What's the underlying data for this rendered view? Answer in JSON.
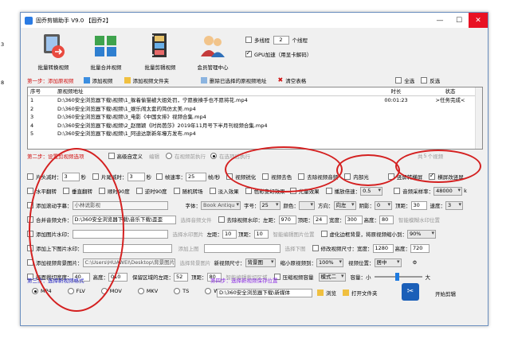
{
  "window": {
    "title": "固乔剪辑助手 V9.0 【固乔2】"
  },
  "side_marks": [
    "3",
    "8"
  ],
  "toolbar": {
    "batch_convert": "批量转换视频",
    "batch_merge": "批量合并视频",
    "batch_edit": "批量剪辑视频",
    "member": "会员管理中心",
    "multithread_label": "多线程",
    "threads_value": "2",
    "threads_unit": "个线程",
    "gpu_label": "GPU加速（用显卡解码）",
    "gpu_checked": true
  },
  "step1": {
    "label": "第一步：添加原视频",
    "add_video": "添加视频",
    "add_folder": "添加视频文件夹",
    "delete_selected": "删除已选择的原视频地址",
    "clear_table": "清空表格",
    "select_all": "全选",
    "invert": "反选"
  },
  "table": {
    "headers": [
      "序号",
      "原视频地址",
      "时长",
      "状态"
    ],
    "rows": [
      [
        "1",
        "D:\\360安全浏览器下载\\视频\\1_躲着偷猫被大姐处罚，宁愿挨揍手也不愿将花.mp4",
        "00:01:23",
        ">任务完成<"
      ],
      [
        "2",
        "D:\\360安全浏览器下载\\视频\\1_娱乐闹太套的简仿太美.mp4",
        "",
        ""
      ],
      [
        "3",
        "D:\\360安全浏览器下载\\视频\\3_电影《中国女排》视频合集.mp4",
        "",
        ""
      ],
      [
        "4",
        "D:\\360安全浏览器下载\\视频\\2_赵丽颖《时尚芭莎》2019年11月号下半月刊视频合集.mp4",
        "",
        ""
      ],
      [
        "5",
        "D:\\360安全浏览器下载\\视频\\1_阿迪达斯新年壕方发布.mp4",
        "",
        ""
      ]
    ]
  },
  "step2": {
    "label": "第二步：设置剪视频选项",
    "advanced": "高级自定义",
    "edit": "编辑",
    "before_video": "在视频前执行",
    "after_video": "在选项后执行",
    "total_label": "共",
    "total_value": "5",
    "total_unit": "个视频",
    "head_trim": "片头减时：",
    "head_val": "3",
    "sec": "秒",
    "tail_trim": "片尾减时：",
    "tail_val": "3",
    "frame_rate": "帧速率：",
    "frame_val": "25",
    "fps": "帧/秒",
    "sharpen": "视频锐化",
    "decolor": "视频去色",
    "remove_audio": "去除视频音频",
    "inner_audio": "内部光",
    "vertical_blur": "竖屏转横屏",
    "horiz_to_vert": "横屏改竖屏",
    "hflip": "水平翻转",
    "vflip": "垂直翻转",
    "rot90": "顺时90度",
    "rot_ccw": "逆时90度",
    "rand_trans": "随机转场",
    "fade": "淡入效果",
    "color_shift": "色彩变幻效果",
    "light": "光量效果",
    "speed": "播放倍速：",
    "speed_val": "0.5",
    "sample_rate": "音频采样率：",
    "sample_val": "48000",
    "add_subtitle": "添加滚动字幕：",
    "subtitle_ph": "小林说影视",
    "font_label": "字体：",
    "font_val": "Book Antiqu",
    "size_label": "字号：",
    "size_val": "25",
    "color_label": "颜色：",
    "direction": "方向：",
    "direction_val": "向左",
    "shadow": "阴影：",
    "shadow_val": "0",
    "margin_top": "顶距：",
    "margin_top_val": "30",
    "speed2": "速度：",
    "speed2_val": "3",
    "merge_music": "合并音频文件：",
    "music_path": "D:\\360安全浏览器下载\\音乐下载\\歪歪",
    "add_audio_file": "选择音频文件",
    "remove_watermark": "去除视频水印：",
    "left_label": "左距：",
    "left_val": "970",
    "top_label": "顶距：",
    "top_val": "24",
    "width_label": "宽度：",
    "width_val": "300",
    "height_label": "高度：",
    "height_val": "80",
    "smart_blur": "智能模糊水印位置",
    "add_image_watermark": "添加图片水印：",
    "choose_image": "选择水印图片",
    "left2": "左距：",
    "left2_val": "10",
    "top2": "顶距：",
    "top2_val": "10",
    "smart_watermark": "智能编辑图片位置",
    "virtual_bg": "虚化边框背景，将原视频缩小到：",
    "virtual_val": "90%",
    "add_headtail": "添加上下图片水印：",
    "add_top": "添加上图",
    "add_bottom": "选择下图",
    "resize": "修改视频尺寸：宽度：",
    "resize_w": "1280",
    "resize_h_label": "高度：",
    "resize_h": "720",
    "add_bg_image": "添加视频背景图片：",
    "bg_path": "C:\\Users\\HUAWEI\\Desktop\\背景图片",
    "choose_bg": "选择背景图片",
    "new_size": "新视频尺寸：",
    "new_size_val": "背景图",
    "scale_label": "缩小原视频到：",
    "scale_val": "100%",
    "position": "视频位置：",
    "position_val": "居中",
    "crop": "画面裁切宽度：",
    "crop_val": "40",
    "crop_h": "高度：",
    "crop_h_val": "010",
    "keep_left": "保留区域的左距：",
    "keep_left_val": "52",
    "keep_top": "顶距：",
    "keep_top_val": "80",
    "smart_crop": "智能编辑裁切区域",
    "compress": "压缩视频容量",
    "mode": "模式二",
    "capacity": "容量：小",
    "big": "大"
  },
  "step3": {
    "label": "第三步：选择新视频格式",
    "formats": [
      "MP4",
      "FLV",
      "MOV",
      "MKV",
      "TS",
      "WMV"
    ],
    "selected": "MP4"
  },
  "step4": {
    "label": "第四步：选择新视频保存位置",
    "path": "D:\\360安全浏览器下载\\新媒体",
    "browse": "浏览",
    "open_folder": "打开文件夹"
  },
  "start": {
    "label": "开始剪辑"
  },
  "colors": {
    "accent": "#1b5fb8",
    "highlight_ring": "#d42020",
    "step_red": "#d01010",
    "step_purple": "#8a2be2"
  }
}
